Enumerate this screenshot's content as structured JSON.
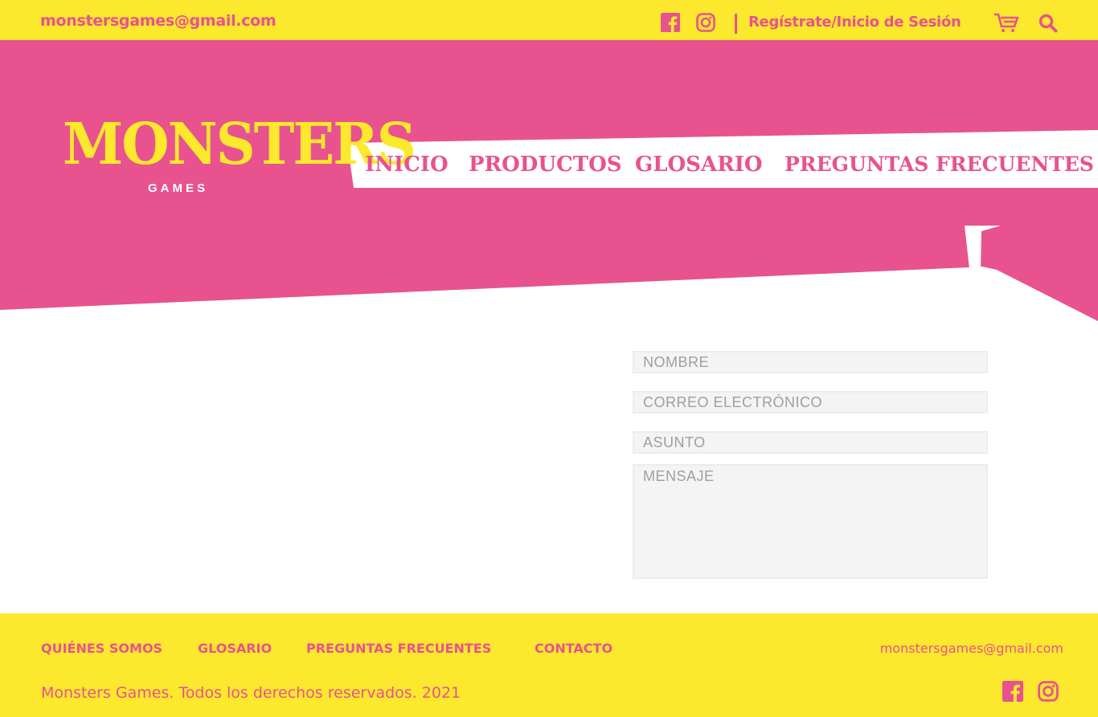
{
  "topbar": {
    "email": "monstersgames@gmail.com",
    "login": "Regístrate/Inicio de Sesión",
    "icons": [
      "facebook-icon",
      "instagram-icon",
      "cart-icon",
      "search-icon"
    ]
  },
  "logo": {
    "main": "MONSTERS",
    "sub": "GAMES"
  },
  "nav": {
    "items": [
      {
        "label": "INICIO"
      },
      {
        "label": "PRODUCTOS"
      },
      {
        "label": "GLOSARIO"
      },
      {
        "label": "PREGUNTAS FRECUENTES"
      }
    ]
  },
  "form": {
    "nombre": "NOMBRE",
    "correo": "CORREO ELECTRÓNICO",
    "asunto": "ASUNTO",
    "mensaje": "MENSAJE"
  },
  "footer": {
    "links": [
      {
        "label": "QUIÉNES SOMOS"
      },
      {
        "label": "GLOSARIO"
      },
      {
        "label": "PREGUNTAS FRECUENTES"
      },
      {
        "label": "CONTACTO"
      }
    ],
    "email": "monstersgames@gmail.com",
    "copyright": "Monsters Games. Todos los derechos reservados. 2021"
  },
  "colors": {
    "yellow": "#fce82c",
    "pink": "#e8528f",
    "field": "#f4f4f4",
    "placeholder": "#a09ea0"
  }
}
